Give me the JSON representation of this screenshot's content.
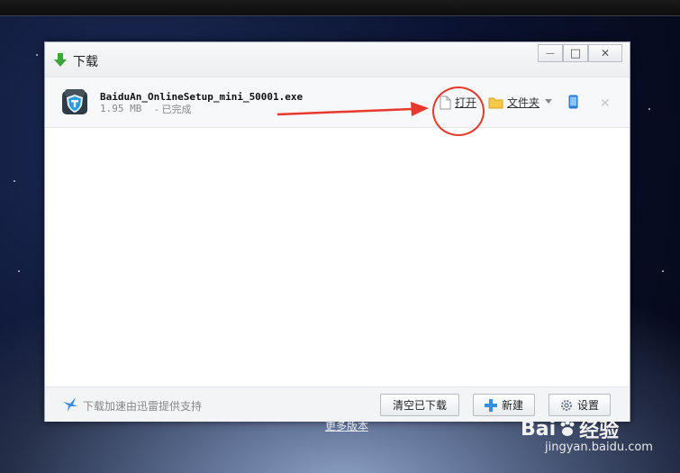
{
  "window": {
    "title": "下载",
    "controls": {
      "minimize": "—",
      "maximize": "□",
      "close": "✕"
    }
  },
  "download": {
    "filename": "BaiduAn_OnlineSetup_mini_50001.exe",
    "size": "1.95 MB",
    "status": "- 已完成",
    "actions": {
      "open": "打开",
      "folder": "文件夹"
    }
  },
  "footer": {
    "credit": "下载加速由迅雷提供支持",
    "buttons": {
      "clear": "清空已下载",
      "new": "新建",
      "settings": "设置"
    }
  },
  "background": {
    "link": "更多版本",
    "watermark_logo_a": "Bai",
    "watermark_logo_b": "经验",
    "watermark_url": "jingyan.baidu.com"
  },
  "colors": {
    "annotation": "#e8392e",
    "title_icon": "#3aa63a",
    "accent": "#2b7bd6"
  }
}
